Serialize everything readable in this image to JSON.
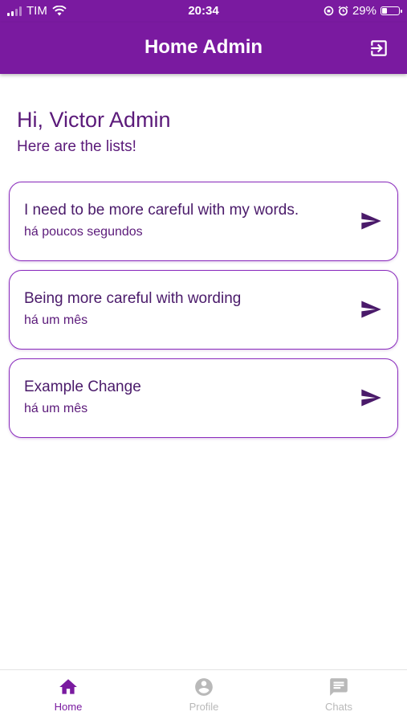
{
  "status": {
    "carrier": "TIM",
    "time": "20:34",
    "battery": "29%",
    "battery_level": 0.29
  },
  "header": {
    "title": "Home Admin",
    "logout_icon": "logout-icon"
  },
  "greeting": {
    "title": "Hi, Victor Admin",
    "subtitle": "Here are the lists!"
  },
  "lists": [
    {
      "title": "I need to be more careful with my words.",
      "time": "há poucos segundos"
    },
    {
      "title": "Being more careful with wording",
      "time": "há um mês"
    },
    {
      "title": "Example Change",
      "time": "há um mês"
    }
  ],
  "nav": {
    "items": [
      {
        "label": "Home",
        "icon": "home-icon",
        "active": true
      },
      {
        "label": "Profile",
        "icon": "account-icon",
        "active": false
      },
      {
        "label": "Chats",
        "icon": "chat-icon",
        "active": false
      }
    ]
  },
  "colors": {
    "primary": "#7a1aa0",
    "text_purple": "#5b1a7a",
    "inactive": "#b9b9b9"
  }
}
